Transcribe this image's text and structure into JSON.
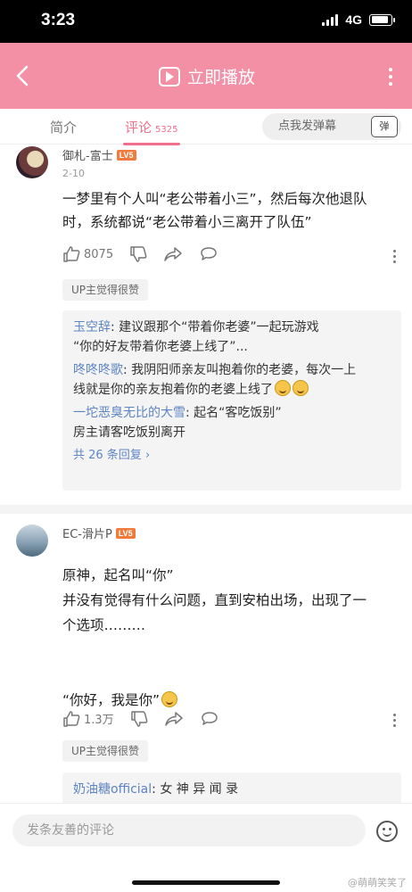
{
  "status_bar": {
    "time": "3:23",
    "network": "4G",
    "battery_level": 0.9
  },
  "nav": {
    "title": "立即播放"
  },
  "tabs": [
    {
      "label": "简介"
    },
    {
      "label": "评论",
      "count": "5325"
    }
  ],
  "danmaku": {
    "placeholder": "点我发弹幕",
    "toggle_label": "弹"
  },
  "comments": [
    {
      "user": "御札-富士",
      "level": "LV5",
      "date": "2-10",
      "lines": [
        "一梦里有个人叫“老公带着小三”，然后每次他退队",
        "时，系统都说“老公带着小三离开了队伍”"
      ],
      "likes": "8075",
      "up_badge": "UP主觉得很赞",
      "replies": [
        {
          "name": "玉空辞",
          "text": ": 建议跟那个“带着你老婆”一起玩游戏",
          "text2": "“你的好友带着你老婆上线了”..."
        },
        {
          "name": "咚咚咚歌",
          "text": ": 我阴阳师亲友叫抱着你的老婆，每次一上",
          "text2": "线就是你的亲友抱着你的老婆上线了"
        },
        {
          "name": "一坨恶臭无比的大雪",
          "text": ": 起名“客吃饭别”",
          "text2": "房主请客吃饭别离开"
        }
      ],
      "more_replies": "共 26 条回复 ›"
    },
    {
      "user": "EC-滑片P",
      "level": "LV5",
      "lines": [
        "原神，起名叫“你”",
        "并没有觉得有什么问题，直到安柏出场，出现了一",
        "个选项………",
        "",
        "“你好，我是你”"
      ],
      "likes": "1.3万",
      "up_badge": "UP主觉得很赞",
      "replies": [
        {
          "name": "奶油糖official",
          "text": ": 女 神 异 闻 录"
        }
      ]
    }
  ],
  "bottom": {
    "input_placeholder": "发条友善的评论",
    "watermark": "@萌萌笑笑了"
  }
}
